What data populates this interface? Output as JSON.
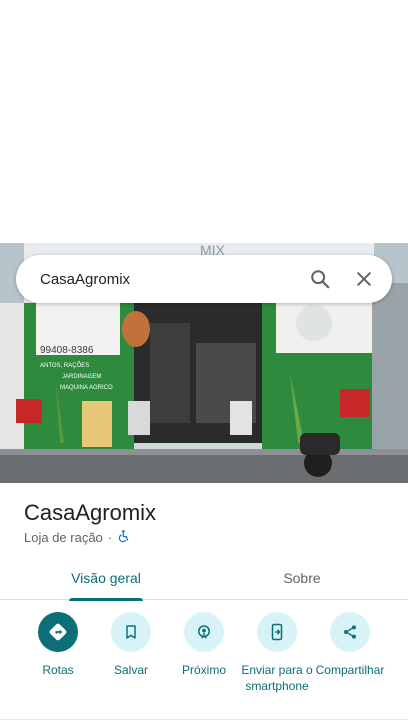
{
  "search": {
    "query": "CasaAgromix"
  },
  "storefront": {
    "phone_sign": "99408-8386",
    "wall_text_1": "ANTOS, RAÇÕES",
    "wall_text_2": "JARDINAGEM",
    "wall_text_3": "MAQUINA AGRICO",
    "roof_sign": "MIX"
  },
  "place": {
    "name": "CasaAgromix",
    "category": "Loja de ração",
    "separator": "·"
  },
  "tabs": [
    {
      "label": "Visão geral",
      "selected": true
    },
    {
      "label": "Sobre",
      "selected": false
    }
  ],
  "actions": [
    {
      "label": "Rotas",
      "icon": "directions-icon"
    },
    {
      "label": "Salvar",
      "icon": "bookmark-icon"
    },
    {
      "label": "Próximo",
      "icon": "nearby-icon"
    },
    {
      "label": "Enviar para o smartphone",
      "icon": "send-to-phone-icon"
    },
    {
      "label": "Compartilhar",
      "icon": "share-icon"
    }
  ],
  "colors": {
    "accent": "#0b6e78",
    "chip": "#d7f3f7",
    "wall_green": "#2e8b3e"
  }
}
